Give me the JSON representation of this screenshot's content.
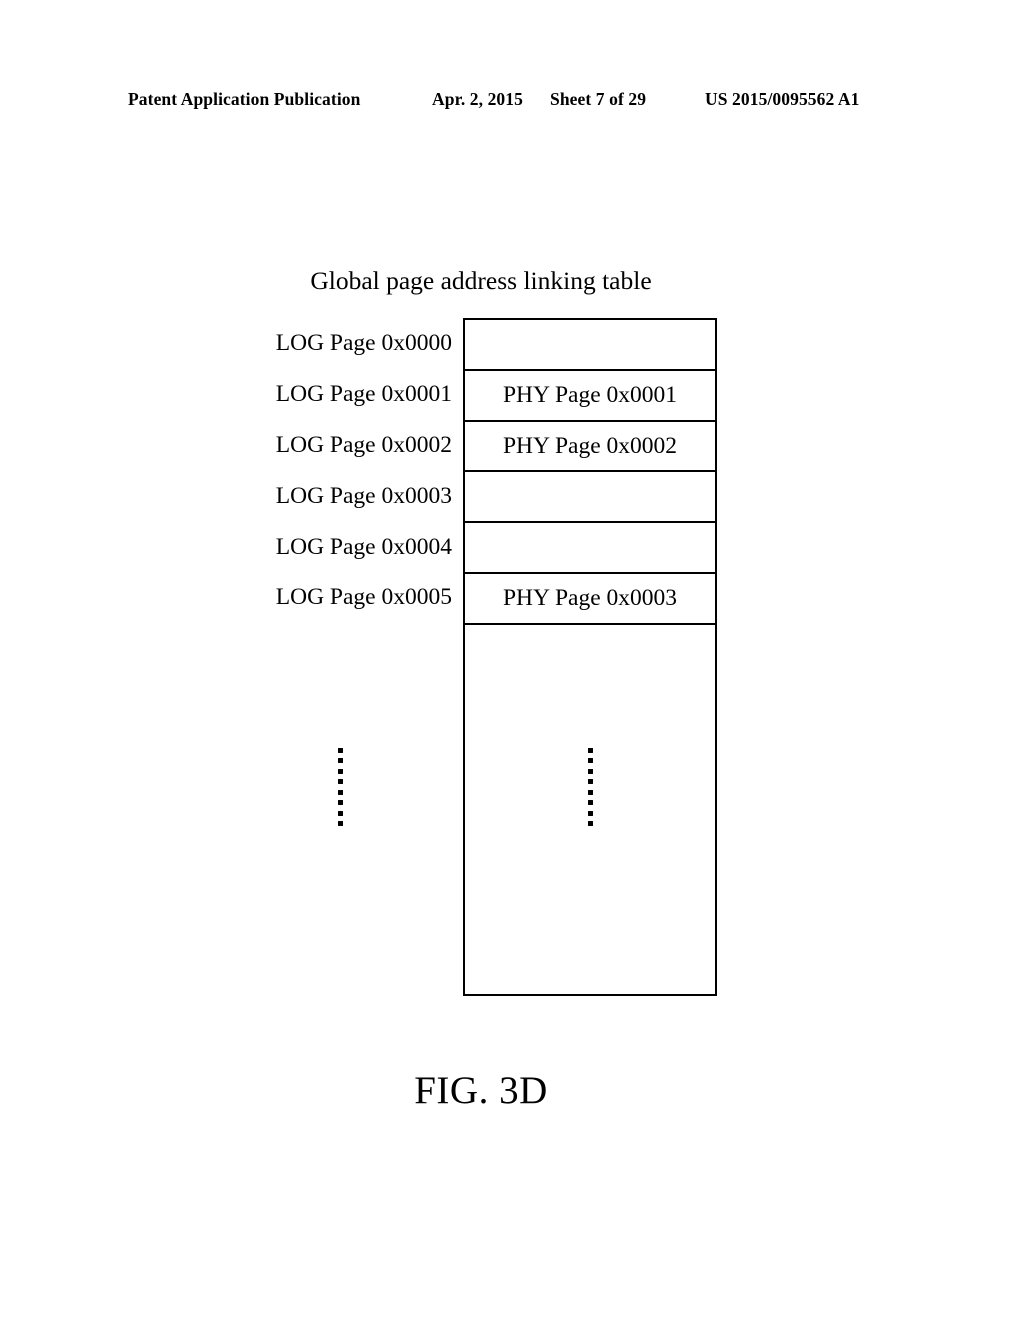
{
  "header": {
    "publication": "Patent Application Publication",
    "date": "Apr. 2, 2015",
    "sheet": "Sheet 7 of 29",
    "patent_number": "US 2015/0095562 A1"
  },
  "figure": {
    "table_title": "Global page address linking table",
    "caption": "FIG. 3D",
    "rows": [
      {
        "log_label": "LOG Page 0x0000",
        "phy_value": ""
      },
      {
        "log_label": "LOG Page 0x0001",
        "phy_value": "PHY Page 0x0001"
      },
      {
        "log_label": "LOG Page 0x0002",
        "phy_value": "PHY Page 0x0002"
      },
      {
        "log_label": "LOG Page 0x0003",
        "phy_value": ""
      },
      {
        "log_label": "LOG Page 0x0004",
        "phy_value": ""
      },
      {
        "log_label": "LOG Page 0x0005",
        "phy_value": "PHY Page 0x0003"
      }
    ],
    "ellipsis": {
      "left_dot_count": 8,
      "right_dot_count": 8,
      "meaning": "vertical-ellipsis"
    },
    "colors": {
      "ink": "#000000",
      "paper": "#ffffff"
    }
  }
}
